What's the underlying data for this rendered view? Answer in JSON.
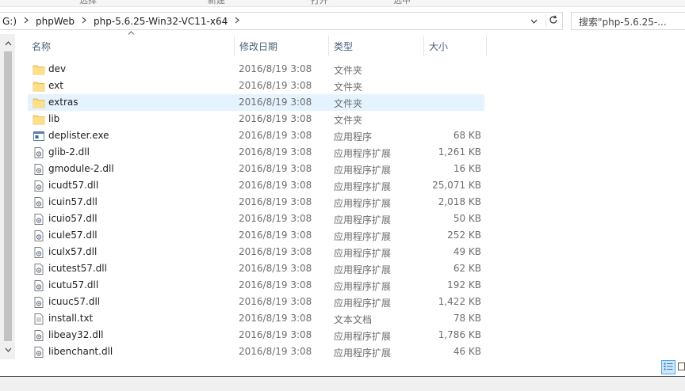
{
  "ribbon": {
    "cut_labels": [
      "选择",
      "新建",
      "打开",
      "选中"
    ]
  },
  "address": {
    "crumbs": [
      "G:)",
      "phpWeb",
      "php-5.6.25-Win32-VC11-x64"
    ],
    "search_placeholder": "搜索\"php-5.6.25-..."
  },
  "columns": {
    "name": "名称",
    "date": "修改日期",
    "type": "类型",
    "size": "大小"
  },
  "files": [
    {
      "name": "dev",
      "date": "2016/8/19 3:08",
      "type": "文件夹",
      "size": "",
      "icon": "folder-icon"
    },
    {
      "name": "ext",
      "date": "2016/8/19 3:08",
      "type": "文件夹",
      "size": "",
      "icon": "folder-icon"
    },
    {
      "name": "extras",
      "date": "2016/8/19 3:08",
      "type": "文件夹",
      "size": "",
      "icon": "folder-icon",
      "selected": true
    },
    {
      "name": "lib",
      "date": "2016/8/19 3:08",
      "type": "文件夹",
      "size": "",
      "icon": "folder-icon"
    },
    {
      "name": "deplister.exe",
      "date": "2016/8/19 3:08",
      "type": "应用程序",
      "size": "68 KB",
      "icon": "exe-icon"
    },
    {
      "name": "glib-2.dll",
      "date": "2016/8/19 3:08",
      "type": "应用程序扩展",
      "size": "1,261 KB",
      "icon": "dll-icon"
    },
    {
      "name": "gmodule-2.dll",
      "date": "2016/8/19 3:08",
      "type": "应用程序扩展",
      "size": "16 KB",
      "icon": "dll-icon"
    },
    {
      "name": "icudt57.dll",
      "date": "2016/8/19 3:08",
      "type": "应用程序扩展",
      "size": "25,071 KB",
      "icon": "dll-icon"
    },
    {
      "name": "icuin57.dll",
      "date": "2016/8/19 3:08",
      "type": "应用程序扩展",
      "size": "2,018 KB",
      "icon": "dll-icon"
    },
    {
      "name": "icuio57.dll",
      "date": "2016/8/19 3:08",
      "type": "应用程序扩展",
      "size": "50 KB",
      "icon": "dll-icon"
    },
    {
      "name": "icule57.dll",
      "date": "2016/8/19 3:08",
      "type": "应用程序扩展",
      "size": "252 KB",
      "icon": "dll-icon"
    },
    {
      "name": "iculx57.dll",
      "date": "2016/8/19 3:08",
      "type": "应用程序扩展",
      "size": "49 KB",
      "icon": "dll-icon"
    },
    {
      "name": "icutest57.dll",
      "date": "2016/8/19 3:08",
      "type": "应用程序扩展",
      "size": "62 KB",
      "icon": "dll-icon"
    },
    {
      "name": "icutu57.dll",
      "date": "2016/8/19 3:08",
      "type": "应用程序扩展",
      "size": "192 KB",
      "icon": "dll-icon"
    },
    {
      "name": "icuuc57.dll",
      "date": "2016/8/19 3:08",
      "type": "应用程序扩展",
      "size": "1,422 KB",
      "icon": "dll-icon"
    },
    {
      "name": "install.txt",
      "date": "2016/8/19 3:08",
      "type": "文本文档",
      "size": "78 KB",
      "icon": "txt-icon"
    },
    {
      "name": "libeay32.dll",
      "date": "2016/8/19 3:08",
      "type": "应用程序扩展",
      "size": "1,786 KB",
      "icon": "dll-icon"
    },
    {
      "name": "libenchant.dll",
      "date": "2016/8/19 3:08",
      "type": "应用程序扩展",
      "size": "46 KB",
      "icon": "dll-icon"
    }
  ],
  "colors": {
    "selection": "#e5f3ff",
    "header_text": "#4c607a",
    "folder": "#f8d775",
    "view_active": "#cce8ff"
  }
}
